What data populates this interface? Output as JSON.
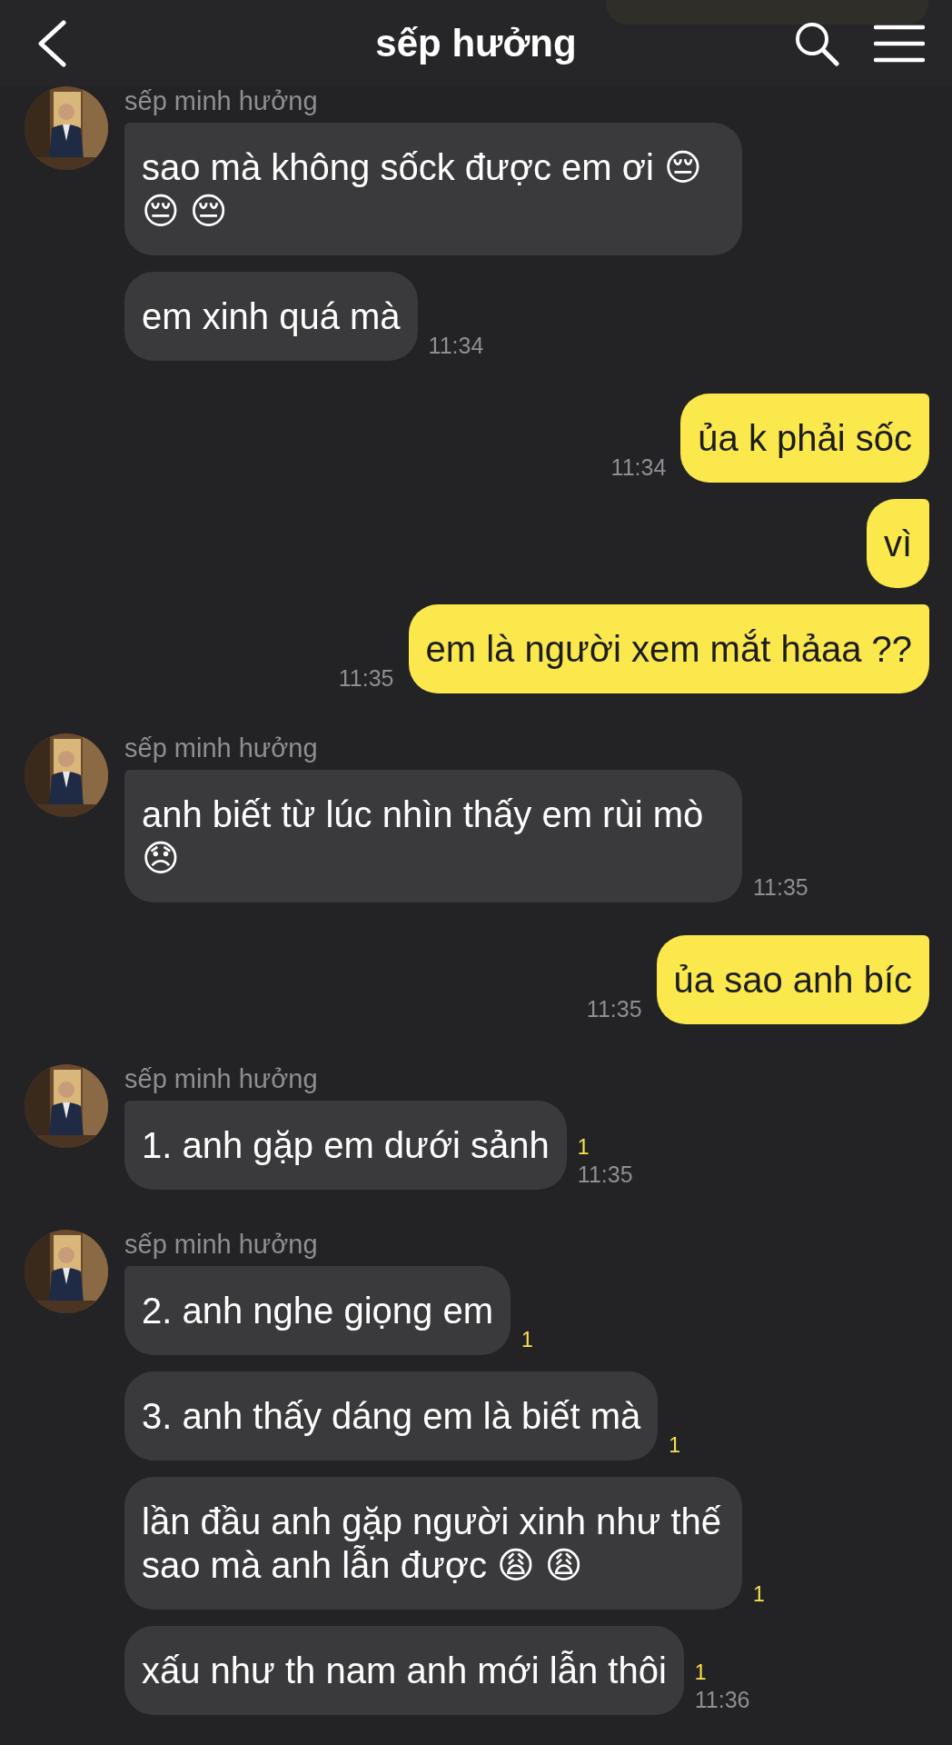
{
  "header": {
    "title": "sếp hưởng"
  },
  "items": [
    {
      "kind": "incoming",
      "sender": "sếp minh hưởng",
      "messages": [
        {
          "text": "sao mà không sốck được em ơi 😔 😔 😔"
        },
        {
          "text": "em xinh quá mà",
          "time": "11:34"
        }
      ]
    },
    {
      "kind": "outgoing",
      "text": "ủa k phải sốc",
      "time": "11:34"
    },
    {
      "kind": "outgoing",
      "text": "vì"
    },
    {
      "kind": "outgoing",
      "text": "em là người xem mắt hảaa ??",
      "time": "11:35"
    },
    {
      "kind": "incoming",
      "sender": "sếp minh hưởng",
      "messages": [
        {
          "text": "anh biết từ lúc nhìn thấy em rùi mò 😞",
          "time": "11:35"
        }
      ]
    },
    {
      "kind": "outgoing",
      "text": "ủa sao anh bíc",
      "time": "11:35"
    },
    {
      "kind": "incoming",
      "sender": "sếp minh hưởng",
      "messages": [
        {
          "text": "1. anh gặp em dưới sảnh",
          "unread": "1",
          "time": "11:35"
        }
      ]
    },
    {
      "kind": "incoming",
      "sender": "sếp minh hưởng",
      "messages": [
        {
          "text": "2. anh nghe giọng em",
          "unread": "1"
        },
        {
          "text": "3. anh thấy dáng em là biết mà",
          "unread": "1"
        },
        {
          "text": "lần đầu anh gặp người xinh như thế sao mà anh lẫn được 😩 😩",
          "unread": "1"
        },
        {
          "text": "xấu như th nam anh mới lẫn thôi",
          "unread": "1",
          "time": "11:36"
        }
      ]
    }
  ]
}
